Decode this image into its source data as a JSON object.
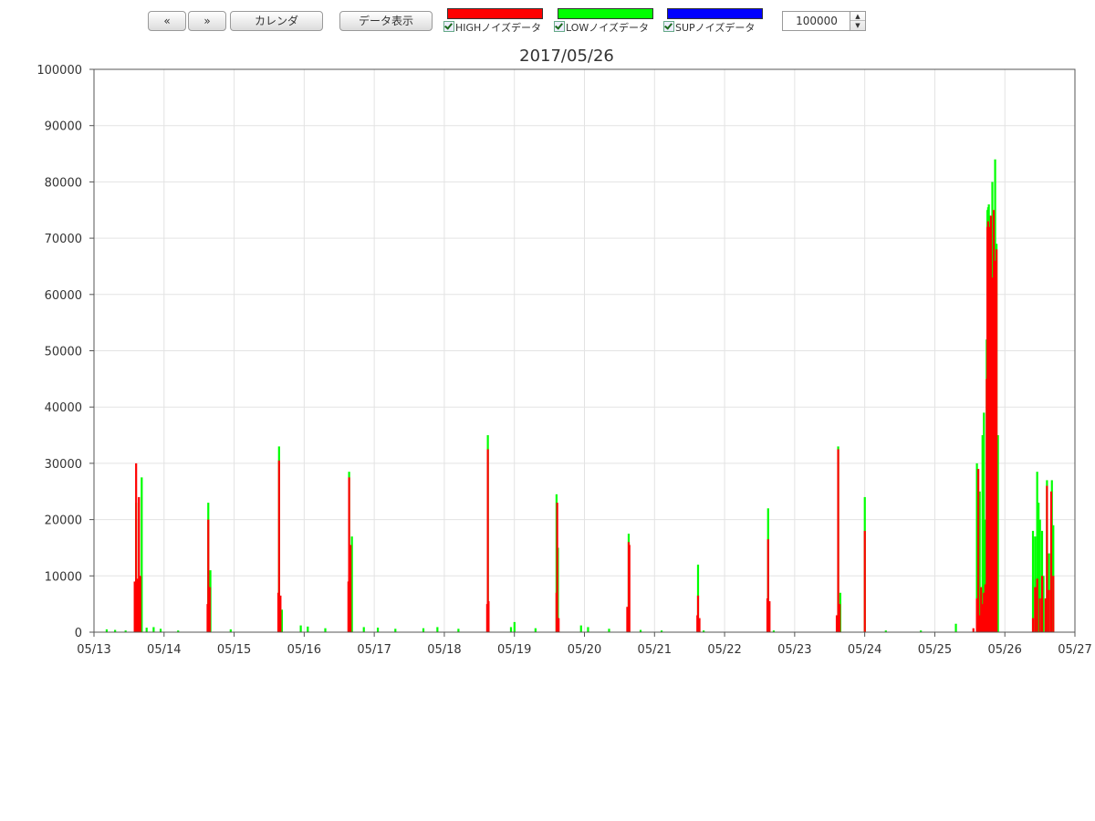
{
  "toolbar": {
    "prev_label": "«",
    "next_label": "»",
    "calendar_label": "カレンダ",
    "show_data_label": "データ表示",
    "series_toggles": [
      {
        "label": "HIGHノイズデータ",
        "color": "#ff0000",
        "checked": true
      },
      {
        "label": "LOWノイズデータ",
        "color": "#00ff00",
        "checked": true
      },
      {
        "label": "SUPノイズデータ",
        "color": "#0000ff",
        "checked": true
      }
    ],
    "ymax_value": "100000"
  },
  "chart_data": {
    "type": "area",
    "title": "2017/05/26",
    "xlabel": "",
    "ylabel": "",
    "xlim": [
      "05/13",
      "05/27"
    ],
    "ylim": [
      0,
      100000
    ],
    "grid": true,
    "legend": "none",
    "x_ticks": [
      "05/13",
      "05/14",
      "05/15",
      "05/16",
      "05/17",
      "05/18",
      "05/19",
      "05/20",
      "05/21",
      "05/22",
      "05/23",
      "05/24",
      "05/25",
      "05/26",
      "05/27"
    ],
    "y_ticks": [
      "0",
      "10000",
      "20000",
      "30000",
      "40000",
      "50000",
      "60000",
      "70000",
      "80000",
      "90000",
      "100000"
    ],
    "series": [
      {
        "name": "LOWノイズデータ",
        "color": "#00ff00",
        "points": [
          [
            0.18,
            500
          ],
          [
            0.3,
            400
          ],
          [
            0.45,
            300
          ],
          [
            0.6,
            23000
          ],
          [
            0.68,
            27500
          ],
          [
            0.75,
            800
          ],
          [
            0.85,
            900
          ],
          [
            0.95,
            600
          ],
          [
            1.2,
            300
          ],
          [
            1.63,
            23000
          ],
          [
            1.66,
            11000
          ],
          [
            1.95,
            500
          ],
          [
            2.64,
            33000
          ],
          [
            2.68,
            4000
          ],
          [
            2.95,
            1200
          ],
          [
            3.05,
            1000
          ],
          [
            3.3,
            700
          ],
          [
            3.64,
            28500
          ],
          [
            3.68,
            17000
          ],
          [
            3.85,
            900
          ],
          [
            4.05,
            800
          ],
          [
            4.3,
            600
          ],
          [
            4.7,
            700
          ],
          [
            4.9,
            900
          ],
          [
            5.2,
            600
          ],
          [
            5.62,
            35000
          ],
          [
            5.95,
            900
          ],
          [
            6.0,
            1800
          ],
          [
            6.3,
            700
          ],
          [
            6.6,
            24500
          ],
          [
            6.62,
            15000
          ],
          [
            6.95,
            1200
          ],
          [
            7.05,
            900
          ],
          [
            7.35,
            600
          ],
          [
            7.63,
            17500
          ],
          [
            7.8,
            400
          ],
          [
            8.1,
            300
          ],
          [
            8.62,
            12000
          ],
          [
            8.7,
            300
          ],
          [
            9.62,
            22000
          ],
          [
            9.7,
            300
          ],
          [
            10.62,
            33000
          ],
          [
            10.65,
            7000
          ],
          [
            11.0,
            24000
          ],
          [
            11.3,
            300
          ],
          [
            11.8,
            300
          ],
          [
            12.3,
            1500
          ],
          [
            12.6,
            30000
          ],
          [
            12.64,
            25000
          ],
          [
            12.68,
            35000
          ],
          [
            12.7,
            39000
          ],
          [
            12.72,
            20000
          ],
          [
            12.74,
            52000
          ],
          [
            12.75,
            75000
          ],
          [
            12.76,
            75500
          ],
          [
            12.77,
            76000
          ],
          [
            12.78,
            74000
          ],
          [
            12.8,
            73000
          ],
          [
            12.82,
            80000
          ],
          [
            12.84,
            72000
          ],
          [
            12.86,
            84000
          ],
          [
            12.88,
            69000
          ],
          [
            12.9,
            35000
          ],
          [
            13.4,
            18000
          ],
          [
            13.43,
            17000
          ],
          [
            13.46,
            28500
          ],
          [
            13.48,
            23000
          ],
          [
            13.5,
            20000
          ],
          [
            13.53,
            18000
          ],
          [
            13.55,
            10000
          ],
          [
            13.6,
            27000
          ],
          [
            13.63,
            14000
          ],
          [
            13.67,
            27000
          ],
          [
            13.69,
            19000
          ]
        ]
      },
      {
        "name": "HIGHノイズデータ",
        "color": "#ff0000",
        "points": [
          [
            0.58,
            9000
          ],
          [
            0.6,
            30000
          ],
          [
            0.62,
            9500
          ],
          [
            0.64,
            24000
          ],
          [
            0.66,
            10000
          ],
          [
            1.62,
            5000
          ],
          [
            1.63,
            20000
          ],
          [
            1.65,
            8000
          ],
          [
            2.63,
            7000
          ],
          [
            2.64,
            30500
          ],
          [
            2.66,
            6500
          ],
          [
            3.63,
            9000
          ],
          [
            3.64,
            27500
          ],
          [
            3.66,
            15500
          ],
          [
            5.61,
            5000
          ],
          [
            5.62,
            32500
          ],
          [
            5.63,
            5500
          ],
          [
            6.6,
            7000
          ],
          [
            6.61,
            23000
          ],
          [
            6.63,
            2500
          ],
          [
            7.61,
            4500
          ],
          [
            7.63,
            16000
          ],
          [
            7.64,
            15500
          ],
          [
            8.61,
            3000
          ],
          [
            8.62,
            6500
          ],
          [
            8.64,
            2500
          ],
          [
            9.61,
            6000
          ],
          [
            9.62,
            16500
          ],
          [
            9.64,
            5500
          ],
          [
            10.6,
            3000
          ],
          [
            10.62,
            32500
          ],
          [
            10.64,
            5000
          ],
          [
            11.0,
            18000
          ],
          [
            12.55,
            700
          ],
          [
            12.6,
            6000
          ],
          [
            12.62,
            29000
          ],
          [
            12.64,
            3000
          ],
          [
            12.66,
            8000
          ],
          [
            12.68,
            5000
          ],
          [
            12.7,
            7000
          ],
          [
            12.72,
            8500
          ],
          [
            12.74,
            45000
          ],
          [
            12.75,
            72000
          ],
          [
            12.76,
            73000
          ],
          [
            12.77,
            68000
          ],
          [
            12.78,
            72000
          ],
          [
            12.8,
            74000
          ],
          [
            12.82,
            63000
          ],
          [
            12.84,
            75000
          ],
          [
            12.86,
            66000
          ],
          [
            12.88,
            68000
          ],
          [
            13.4,
            2500
          ],
          [
            13.43,
            8000
          ],
          [
            13.46,
            9500
          ],
          [
            13.5,
            6000
          ],
          [
            13.53,
            10000
          ],
          [
            13.58,
            6000
          ],
          [
            13.6,
            26000
          ],
          [
            13.63,
            7500
          ],
          [
            13.66,
            25000
          ],
          [
            13.69,
            10000
          ]
        ]
      }
    ]
  }
}
